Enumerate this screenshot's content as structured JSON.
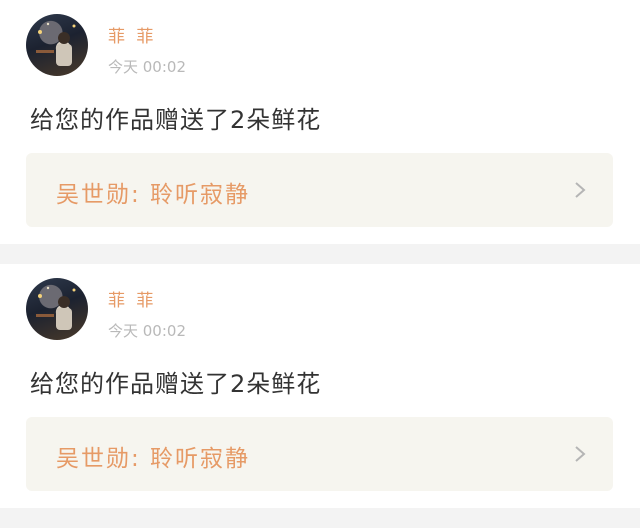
{
  "notifications": [
    {
      "user_name": "菲 菲",
      "timestamp": "今天 00:02",
      "message": "给您的作品赠送了2朵鲜花",
      "work_link": "吴世勋: 聆听寂静",
      "icons": {
        "avatar": "user-avatar-photo",
        "chevron": "chevron-right-icon"
      }
    },
    {
      "user_name": "菲 菲",
      "timestamp": "今天 00:02",
      "message": "给您的作品赠送了2朵鲜花",
      "work_link": "吴世勋: 聆听寂静",
      "icons": {
        "avatar": "user-avatar-photo",
        "chevron": "chevron-right-icon"
      }
    }
  ],
  "colors": {
    "accent": "#e69a66",
    "timestamp": "#b9b9b9",
    "text": "#333333",
    "link_background": "#f6f5ef",
    "divider": "#f3f3f3"
  }
}
